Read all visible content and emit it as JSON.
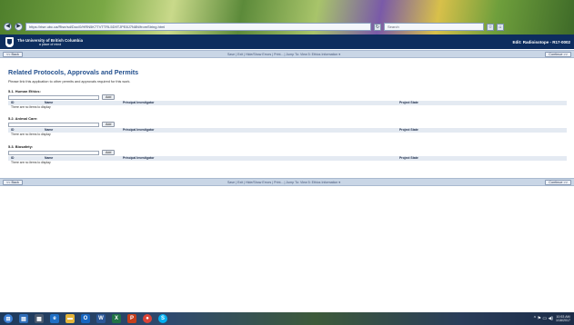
{
  "browser": {
    "url": "https://rise.ubc.ca/Rise/sd/Doc/0/HRN5K7TVTTRL5D9TJPE8J7N8N/fromString.html",
    "search_placeholder": "Search",
    "back_glyph": "◀",
    "forward_glyph": "▶",
    "refresh_glyph": "↻",
    "star_glyph": "☆",
    "home_glyph": "⌂"
  },
  "site": {
    "name": "The University of British Columbia",
    "tagline": "a place of mind",
    "record_id": "Edit: Radioisotope - R17-0002"
  },
  "toolbar": {
    "back_label": "<< Back",
    "links": "Save | Exit | Hide/Show Errors | Print... | Jump To: View 5: Ethics Information ▾",
    "continue_label": "Continue >>"
  },
  "page": {
    "title": "Related Protocols, Approvals and Permits",
    "intro": "Please link this application to other permits and approvals required for this work."
  },
  "sections": [
    {
      "heading": "5.1. Human Ethics:",
      "add_label": "Add",
      "columns": [
        "ID",
        "Name",
        "Principal Investigator",
        "Project State"
      ],
      "empty": "There are no items to display"
    },
    {
      "heading": "5.2. Animal Care:",
      "add_label": "Add",
      "columns": [
        "ID",
        "Name",
        "Principal Investigator",
        "Project State"
      ],
      "empty": "There are no items to display"
    },
    {
      "heading": "5.3. Biosafety:",
      "add_label": "Add",
      "columns": [
        "ID",
        "Name",
        "Principal Investigator",
        "Project State"
      ],
      "empty": "There are no items to display"
    }
  ],
  "taskbar": {
    "icons": [
      "start-icon",
      "file-explorer-icon",
      "store-icon",
      "edge-icon",
      "folder-icon",
      "outlook-icon",
      "word-icon",
      "excel-icon",
      "powerpoint-icon",
      "chrome-icon",
      "skype-icon"
    ],
    "tray_glyphs": "^ ⚑ ▭ ◀)",
    "time": "10:53 AM",
    "date": "1/16/2017"
  },
  "colors": {
    "header_navy": "#0d2d5e",
    "title_blue": "#23508e",
    "toolbar_blue": "#c9d6e6"
  }
}
